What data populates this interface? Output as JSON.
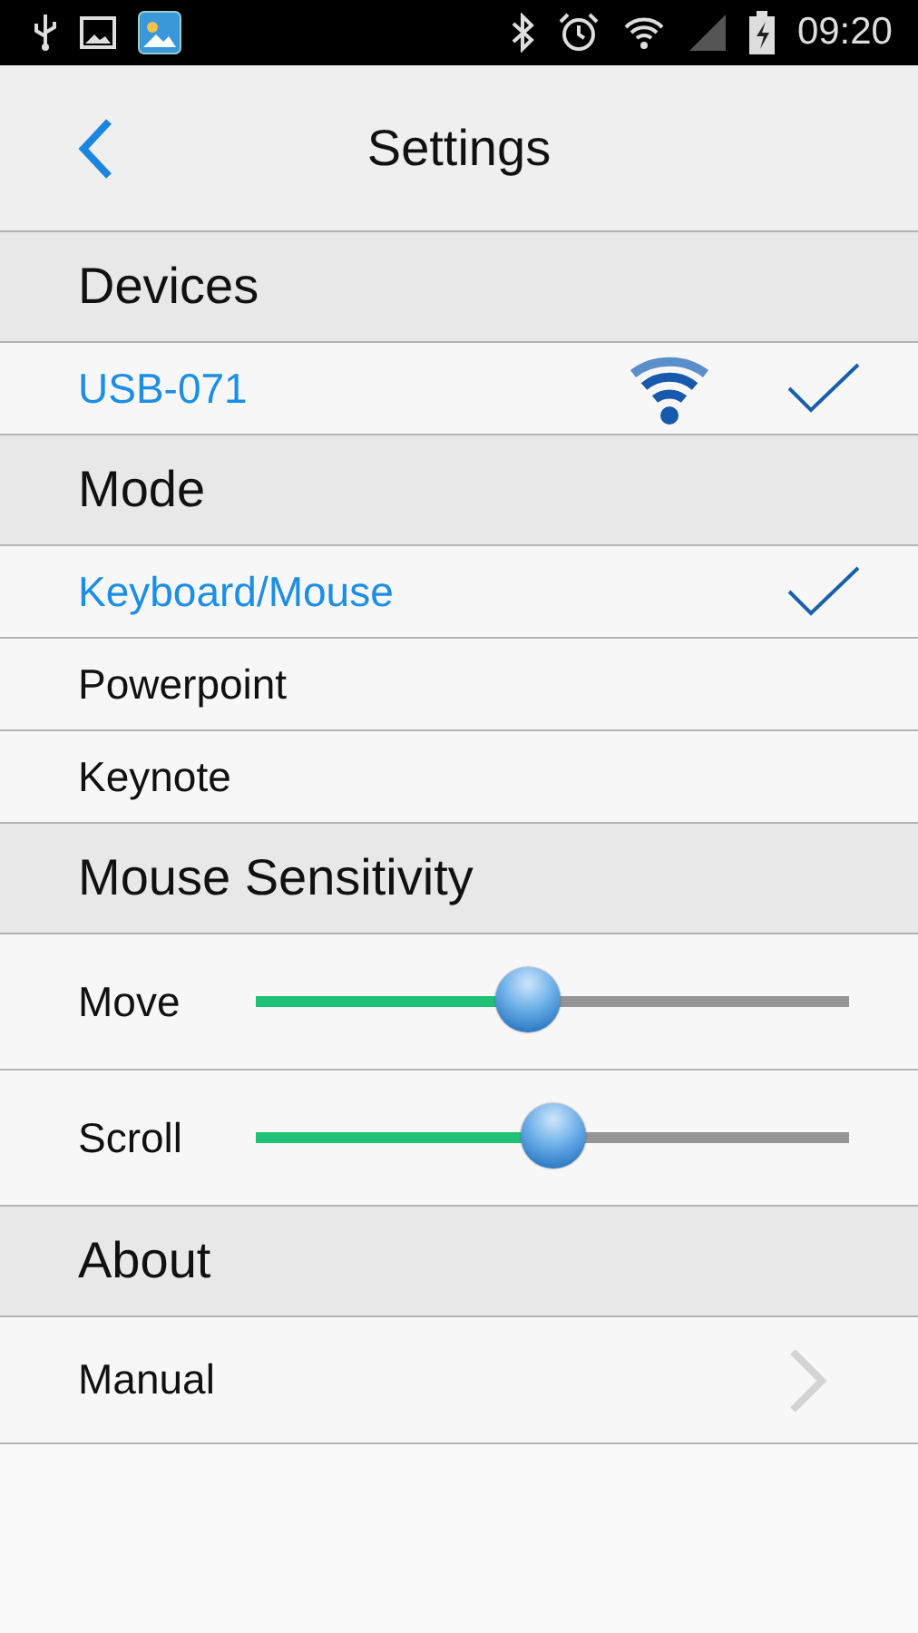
{
  "status_bar": {
    "time": "09:20"
  },
  "header": {
    "title": "Settings"
  },
  "sections": [
    {
      "title": "Devices",
      "items": [
        {
          "kind": "device",
          "label": "USB-071",
          "selected": true
        }
      ]
    },
    {
      "title": "Mode",
      "items": [
        {
          "kind": "option",
          "label": "Keyboard/Mouse",
          "selected": true
        },
        {
          "kind": "option",
          "label": "Powerpoint",
          "selected": false
        },
        {
          "kind": "option",
          "label": "Keynote",
          "selected": false
        }
      ]
    },
    {
      "title": "Mouse Sensitivity",
      "items": [
        {
          "kind": "slider",
          "label": "Move",
          "level": 0.46
        },
        {
          "kind": "slider",
          "label": "Scroll",
          "level": 0.5
        }
      ]
    },
    {
      "title": "About",
      "items": [
        {
          "kind": "link",
          "label": "Manual"
        }
      ]
    }
  ]
}
